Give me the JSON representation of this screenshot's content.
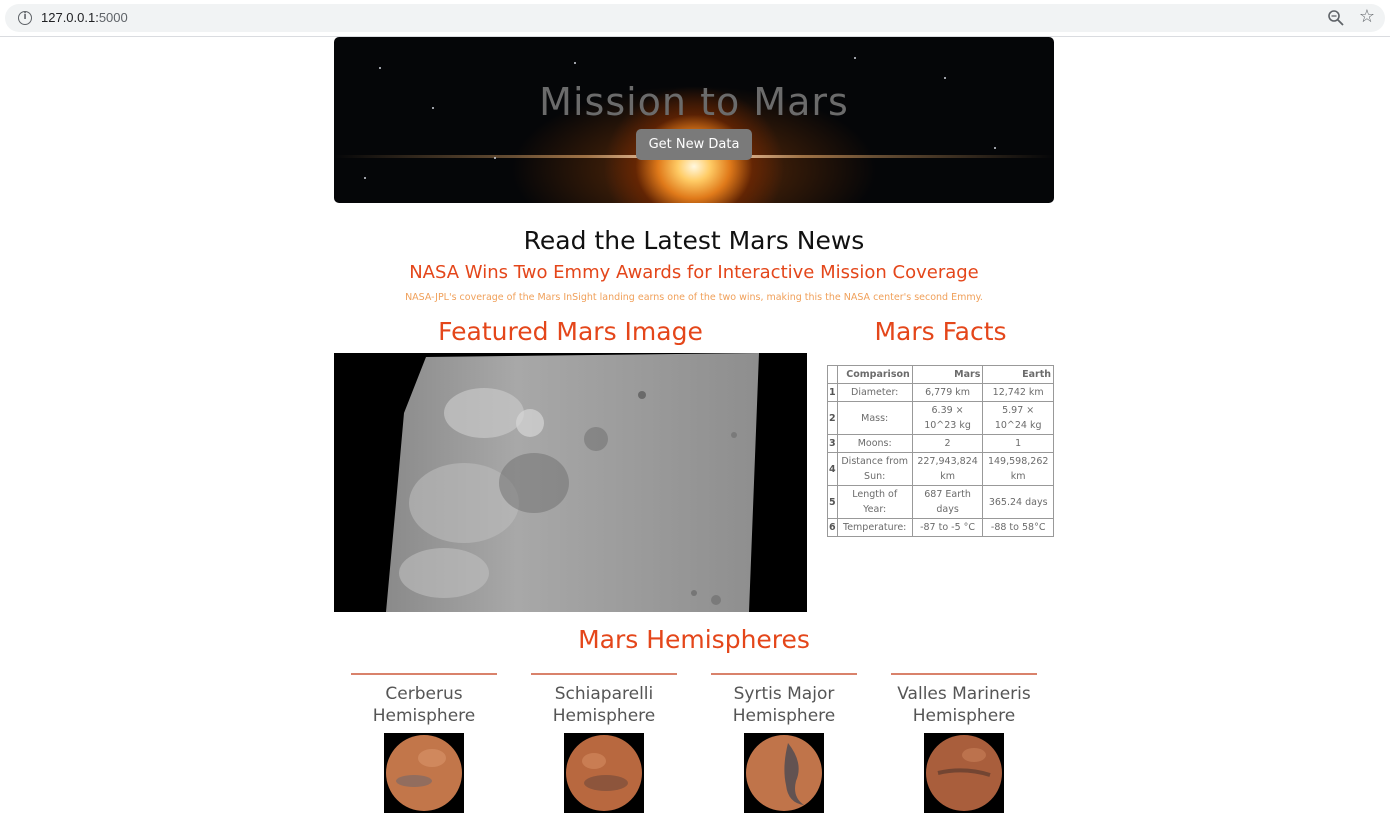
{
  "browser": {
    "url_host": "127.0.0.1:",
    "url_port": "5000"
  },
  "jumbotron": {
    "title": "Mission to Mars",
    "button_label": "Get New Data"
  },
  "news": {
    "heading": "Read the Latest Mars News",
    "title": "NASA Wins Two Emmy Awards for Interactive Mission Coverage",
    "teaser": "NASA-JPL's coverage of the Mars InSight landing earns one of the two wins, making this the NASA center's second Emmy."
  },
  "featured": {
    "heading": "Featured Mars Image"
  },
  "facts": {
    "heading": "Mars Facts",
    "columns": [
      "Comparison",
      "Mars",
      "Earth"
    ],
    "rows": [
      {
        "idx": "1",
        "label": "Diameter:",
        "mars": "6,779 km",
        "earth": "12,742 km"
      },
      {
        "idx": "2",
        "label": "Mass:",
        "mars": "6.39 × 10^23 kg",
        "earth": "5.97 × 10^24 kg"
      },
      {
        "idx": "3",
        "label": "Moons:",
        "mars": "2",
        "earth": "1"
      },
      {
        "idx": "4",
        "label": "Distance from Sun:",
        "mars": "227,943,824 km",
        "earth": "149,598,262 km"
      },
      {
        "idx": "5",
        "label": "Length of Year:",
        "mars": "687 Earth days",
        "earth": "365.24 days"
      },
      {
        "idx": "6",
        "label": "Temperature:",
        "mars": "-87 to -5 °C",
        "earth": "-88 to 58°C"
      }
    ]
  },
  "hemispheres": {
    "heading": "Mars Hemispheres",
    "items": [
      {
        "name": "Cerberus Hemisphere"
      },
      {
        "name": "Schiaparelli Hemisphere"
      },
      {
        "name": "Syrtis Major Hemisphere"
      },
      {
        "name": "Valles Marineris Hemisphere"
      }
    ]
  }
}
